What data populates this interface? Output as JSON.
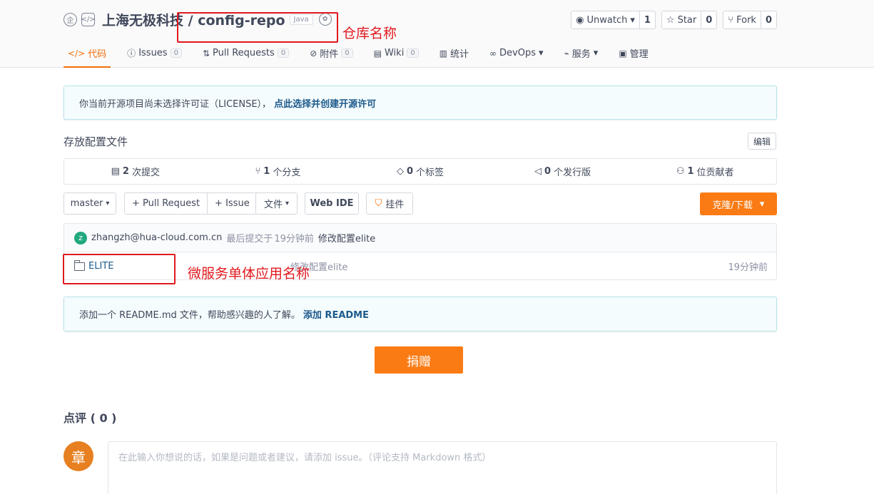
{
  "repo": {
    "owner": "上海无极科技",
    "separator": "/",
    "name": "config-repo",
    "language": "Java"
  },
  "stats": {
    "watch_label": "Unwatch",
    "watch_count": "1",
    "star_label": "Star",
    "star_count": "0",
    "fork_label": "Fork",
    "fork_count": "0"
  },
  "nav": [
    {
      "label": "代码",
      "icon": "code-icon",
      "count": null
    },
    {
      "label": "Issues",
      "icon": "issue-icon",
      "count": "0"
    },
    {
      "label": "Pull Requests",
      "icon": "pull-request-icon",
      "count": "0"
    },
    {
      "label": "附件",
      "icon": "attachment-icon",
      "count": "0"
    },
    {
      "label": "Wiki",
      "icon": "wiki-icon",
      "count": "0"
    },
    {
      "label": "统计",
      "icon": "stats-icon",
      "count": null
    },
    {
      "label": "DevOps",
      "icon": "devops-icon",
      "count": null
    },
    {
      "label": "服务",
      "icon": "service-icon",
      "count": null
    },
    {
      "label": "管理",
      "icon": "manage-icon",
      "count": null
    }
  ],
  "annotations": {
    "repo_name": "仓库名称",
    "service_name": "微服务单体应用名称"
  },
  "license": {
    "text": "你当前开源项目尚未选择许可证（LICENSE），",
    "link": "点此选择并创建开源许可"
  },
  "description": "存放配置文件",
  "edit_label": "编辑",
  "summary": {
    "commits_num": "2",
    "commits_label": "次提交",
    "branches_num": "1",
    "branches_label": "个分支",
    "tags_num": "0",
    "tags_label": "个标签",
    "releases_num": "0",
    "releases_label": "个发行版",
    "contributors_num": "1",
    "contributors_label": "位贡献者"
  },
  "toolbar": {
    "branch": "master",
    "pull_request": "+ Pull Request",
    "issue": "+ Issue",
    "file": "文件",
    "web_ide": "Web IDE",
    "widget": "挂件",
    "clone": "克隆/下载"
  },
  "commit": {
    "avatar_letter": "z",
    "author": "zhangzh@hua-cloud.com.cn",
    "prefix": "最后提交于",
    "time": "19分钟前",
    "message": "修改配置elite"
  },
  "files": [
    {
      "name": "ELITE",
      "message": "修改配置elite",
      "time": "19分钟前"
    }
  ],
  "readme": {
    "text": "添加一个 README.md 文件，帮助感兴趣的人了解。",
    "link": "添加 README"
  },
  "donate_label": "捐赠",
  "comments": {
    "title": "点评 ( 0 )",
    "avatar_char": "章",
    "placeholder": "在此输入你想说的话，如果是问题或者建议，请添加 issue。（评论支持 Markdown 格式）"
  },
  "colors": {
    "accent": "#fa7b14",
    "annotation": "#e0191e",
    "link": "#1c5a8c"
  }
}
